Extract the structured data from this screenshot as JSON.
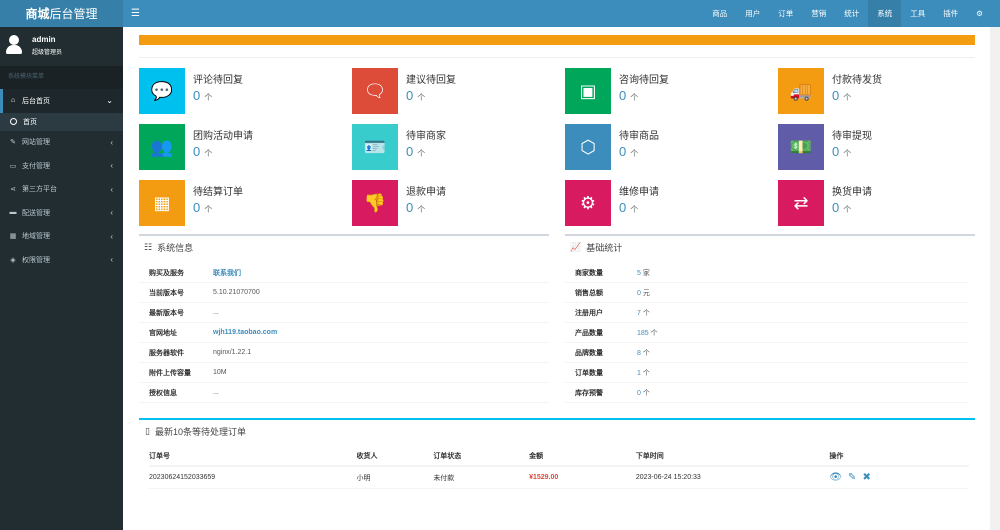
{
  "brand": {
    "bold": "商城",
    "rest": "后台管理"
  },
  "user": {
    "name": "admin",
    "role": "超级管理员"
  },
  "sidebar": {
    "header": "系统模块菜单",
    "items": [
      {
        "label": "后台首页",
        "icon": "home-icon",
        "glyph": "⌂",
        "active": true
      },
      {
        "label": "网站管理",
        "icon": "wrench-icon",
        "glyph": "✎"
      },
      {
        "label": "支付管理",
        "icon": "credit-card-icon",
        "glyph": "▭"
      },
      {
        "label": "第三方平台",
        "icon": "share-icon",
        "glyph": "⋖"
      },
      {
        "label": "配送管理",
        "icon": "truck-icon",
        "glyph": "▬"
      },
      {
        "label": "地域管理",
        "icon": "map-icon",
        "glyph": "▦"
      },
      {
        "label": "权限管理",
        "icon": "tags-icon",
        "glyph": "◈"
      }
    ],
    "sub": "首页"
  },
  "topnav": {
    "links": [
      "商品",
      "用户",
      "订单",
      "营销",
      "统计",
      "系统",
      "工具",
      "插件"
    ],
    "active": "系统",
    "gear": "⚙"
  },
  "boxes": [
    {
      "label": "评论待回复",
      "count": "0",
      "unit": "个",
      "color": "#00c0ef",
      "icon": "comment-icon",
      "glyph": "💬"
    },
    {
      "label": "建议待回复",
      "count": "0",
      "unit": "个",
      "color": "#dd4b39",
      "icon": "comments-icon",
      "glyph": "🗨"
    },
    {
      "label": "咨询待回复",
      "count": "0",
      "unit": "个",
      "color": "#00a65a",
      "icon": "twitch-icon",
      "glyph": "▣"
    },
    {
      "label": "付款待发货",
      "count": "0",
      "unit": "个",
      "color": "#f39c12",
      "icon": "truck-icon",
      "glyph": "🚚"
    },
    {
      "label": "团购活动申请",
      "count": "0",
      "unit": "个",
      "color": "#00a65a",
      "icon": "users-icon",
      "glyph": "👥"
    },
    {
      "label": "待审商家",
      "count": "0",
      "unit": "个",
      "color": "#39cccc",
      "icon": "id-card-icon",
      "glyph": "🪪"
    },
    {
      "label": "待审商品",
      "count": "0",
      "unit": "个",
      "color": "#3c8dbc",
      "icon": "cube-icon",
      "glyph": "⬡"
    },
    {
      "label": "待审提现",
      "count": "0",
      "unit": "个",
      "color": "#605ca8",
      "icon": "money-icon",
      "glyph": "💵"
    },
    {
      "label": "待结算订单",
      "count": "0",
      "unit": "个",
      "color": "#f39c12",
      "icon": "calculator-icon",
      "glyph": "▦"
    },
    {
      "label": "退款申请",
      "count": "0",
      "unit": "个",
      "color": "#d81b60",
      "icon": "thumbs-down-icon",
      "glyph": "👎"
    },
    {
      "label": "维修申请",
      "count": "0",
      "unit": "个",
      "color": "#d81b60",
      "icon": "cog-icon",
      "glyph": "⚙"
    },
    {
      "label": "换货申请",
      "count": "0",
      "unit": "个",
      "color": "#d81b60",
      "icon": "retweet-icon",
      "glyph": "⇄"
    }
  ],
  "sysinfo": {
    "title": "系统信息",
    "rows": [
      {
        "label": "购买及服务",
        "value": "联系我们",
        "style": "link"
      },
      {
        "label": "当前版本号",
        "value": "5.10.21070700",
        "style": ""
      },
      {
        "label": "最新版本号",
        "value": "...",
        "style": ""
      },
      {
        "label": "官网地址",
        "value": "wjh119.taobao.com",
        "style": "link"
      },
      {
        "label": "服务器软件",
        "value": "nginx/1.22.1",
        "style": ""
      },
      {
        "label": "附件上传容量",
        "value": "10M",
        "style": ""
      },
      {
        "label": "授权信息",
        "value": "...",
        "style": ""
      }
    ]
  },
  "stats": {
    "title": "基础统计",
    "rows": [
      {
        "label": "商家数量",
        "value": "5",
        "unit": "家"
      },
      {
        "label": "销售总额",
        "value": "0",
        "unit": "元"
      },
      {
        "label": "注册用户",
        "value": "7",
        "unit": "个"
      },
      {
        "label": "产品数量",
        "value": "185",
        "unit": "个"
      },
      {
        "label": "品牌数量",
        "value": "8",
        "unit": "个"
      },
      {
        "label": "订单数量",
        "value": "1",
        "unit": "个"
      },
      {
        "label": "库存预警",
        "value": "0",
        "unit": "个"
      }
    ]
  },
  "orders": {
    "title": "最新10条等待处理订单",
    "headers": [
      "订单号",
      "收货人",
      "订单状态",
      "金额",
      "下单时间",
      "操作"
    ],
    "rows": [
      {
        "no": "20230624152033659",
        "receiver": "小明",
        "status": "未付款",
        "amount": "¥1529.00",
        "time": "2023-06-24 15:20:33"
      }
    ]
  }
}
